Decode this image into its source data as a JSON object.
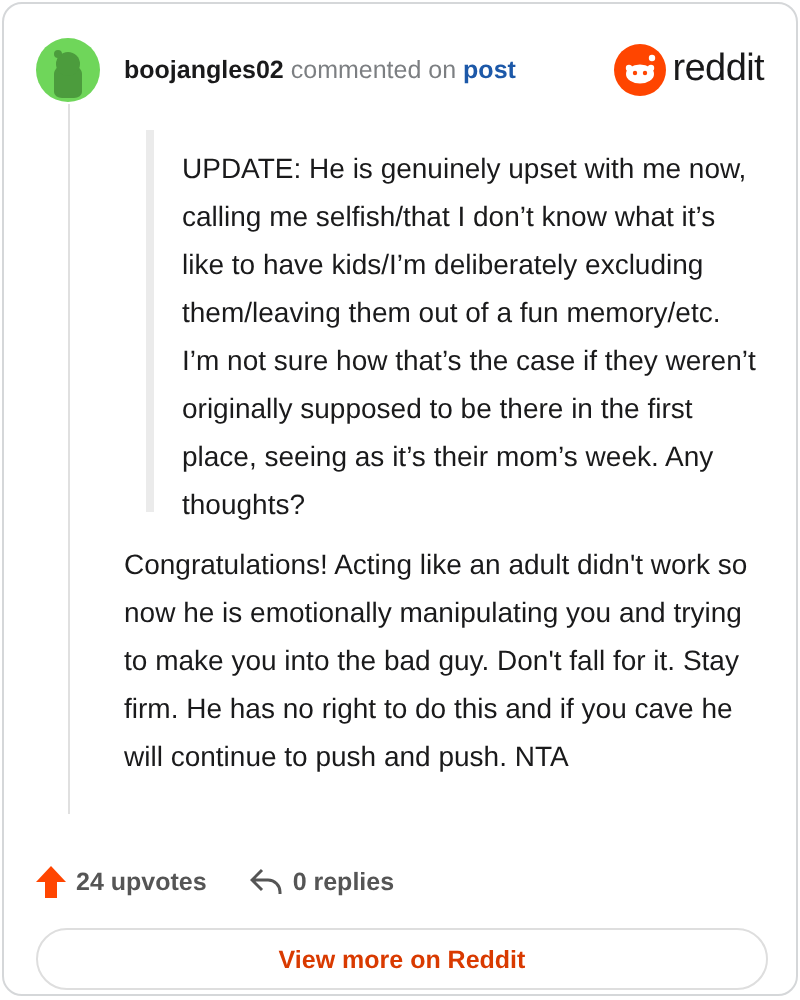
{
  "header": {
    "username": "boojangles02",
    "action": "commented on",
    "link": "post",
    "brand": "reddit"
  },
  "quote": "UPDATE: He is genuinely upset with me now, calling me selfish/that I don’t know what it’s like to have kids/I’m deliberately excluding them/leaving them out of a fun memory/etc. I’m not sure how that’s the case if they weren’t originally supposed to be there in the first place, seeing as it’s their mom’s week. Any thoughts?",
  "comment": "Congratulations! Acting like an adult didn't work so now he is emotionally manipulating you and trying to make you into the bad guy. Don't fall for it. Stay firm. He has no right to do this and if you cave he will continue to push and push. NTA",
  "footer": {
    "upvotes": "24 upvotes",
    "replies": "0 replies"
  },
  "button": "View more on Reddit"
}
